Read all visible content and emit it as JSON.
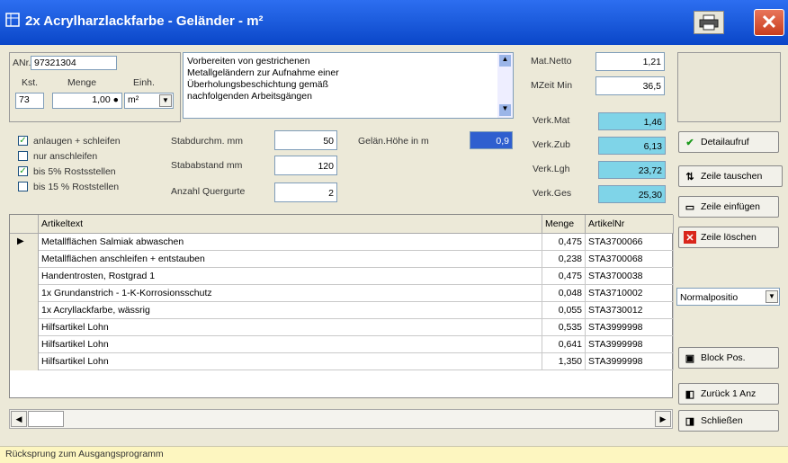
{
  "window": {
    "title": "2x  Acrylharzlackfarbe - Geländer - m²",
    "title_icon": "grid-icon",
    "print_icon": "printer-icon",
    "close_icon": "close-icon",
    "close_glyph": "✕"
  },
  "form": {
    "artnr_label": "ANr.",
    "artnr_value": "97321304",
    "kst_label": "Kst.",
    "kst_value": "73",
    "menge_label": "Menge",
    "menge_value": "1,00 ●",
    "einh_label": "Einh.",
    "einh_value": "m²",
    "description": "Vorbereiten von gestrichenen\nMetallgeländern zur Aufnahme einer\nÜberholungsbeschichtung gemäß\nnachfolgenden Arbeitsgängen",
    "checkboxes": [
      {
        "label": "anlaugen + schleifen",
        "checked": true
      },
      {
        "label": "nur anschleifen",
        "checked": false
      },
      {
        "label": "bis 5% Rostsstellen",
        "checked": true
      },
      {
        "label": "bis 15 % Roststellen",
        "checked": false
      }
    ],
    "stabdurchm_label": "Stabdurchm. mm",
    "stabdurchm_value": "50",
    "stababstand_label": "Stababstand mm",
    "stababstand_value": "120",
    "quergurte_label": "Anzahl Quergurte",
    "quergurte_value": "2",
    "gelhoehe_label": "Gelän.Höhe in m",
    "gelhoehe_value": "0,9",
    "matnetto_label": "Mat.Netto",
    "matnetto_value": "1,21",
    "mzeit_label": "MZeit Min",
    "mzeit_value": "36,5",
    "verk_mat_label": "Verk.Mat",
    "verk_mat_value": "1,46",
    "verk_zub_label": "Verk.Zub",
    "verk_zub_value": "6,13",
    "verk_lgh_label": "Verk.Lgh",
    "verk_lgh_value": "23,72",
    "verk_ges_label": "Verk.Ges",
    "verk_ges_value": "25,30"
  },
  "buttons": {
    "detailaufruf": "Detailaufruf",
    "tauschen": "Zeile tauschen",
    "einfuegen": "Zeile einfügen",
    "loeschen": "Zeile löschen",
    "normalposition": "Normalpositio",
    "block": "Block Pos.",
    "zurueck": "Zurück 1 Anz",
    "schliessen": "Schließen"
  },
  "table": {
    "headers": [
      "Artikeltext",
      "Menge",
      "ArtikelNr"
    ],
    "rows": [
      {
        "text": "Metallflächen Salmiak abwaschen",
        "menge": "0,475",
        "nr": "STA3700066",
        "current": true
      },
      {
        "text": "Metallflächen anschleifen + entstauben",
        "menge": "0,238",
        "nr": "STA3700068",
        "current": false
      },
      {
        "text": "Handentrosten, Rostgrad 1",
        "menge": "0,475",
        "nr": "STA3700038",
        "current": false
      },
      {
        "text": "1x Grundanstrich - 1-K-Korrosionsschutz",
        "menge": "0,048",
        "nr": "STA3710002",
        "current": false
      },
      {
        "text": "1x Acryllackfarbe, wässrig",
        "menge": "0,055",
        "nr": "STA3730012",
        "current": false
      },
      {
        "text": "Hilfsartikel Lohn",
        "menge": "0,535",
        "nr": "STA3999998",
        "current": false
      },
      {
        "text": "Hilfsartikel Lohn",
        "menge": "0,641",
        "nr": "STA3999998",
        "current": false
      },
      {
        "text": "Hilfsartikel Lohn",
        "menge": "1,350",
        "nr": "STA3999998",
        "current": false
      }
    ]
  },
  "status": "Rücksprung zum Ausgangsprogramm"
}
